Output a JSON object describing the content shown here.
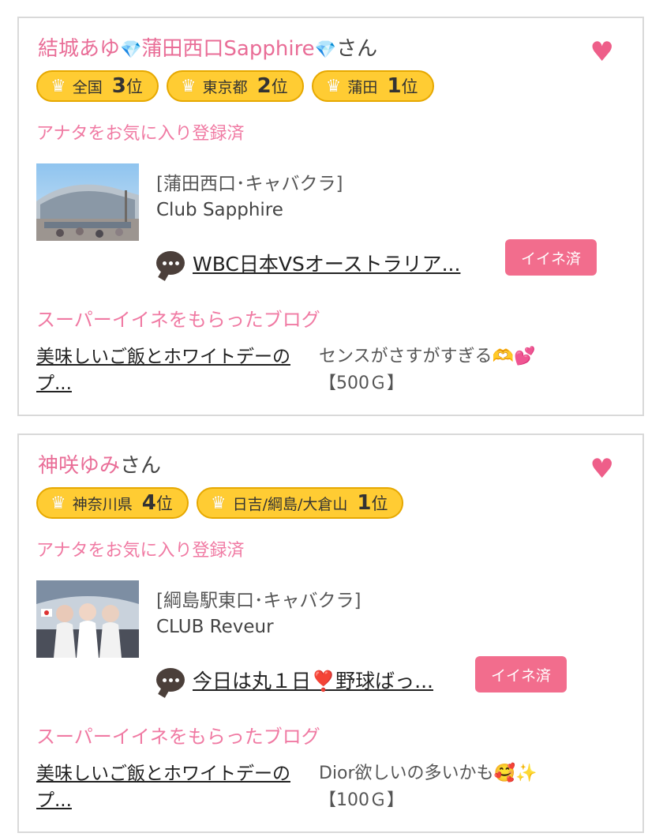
{
  "cards": [
    {
      "name_parts": [
        "結城あゆ",
        "💎",
        "蒲田西口Sapphire",
        "💎"
      ],
      "honorific": "さん",
      "heart_icon": "heart-icon",
      "ranks": [
        {
          "area": "全国",
          "rank": "3",
          "suffix": "位"
        },
        {
          "area": "東京都",
          "rank": "2",
          "suffix": "位"
        },
        {
          "area": "蒲田",
          "rank": "1",
          "suffix": "位"
        }
      ],
      "favorite_status": "アナタをお気に入り登録済",
      "shop_category": "[蒲田西口･キャバクラ]",
      "shop_name": "Club Sapphire",
      "post_title": "WBC日本VSオーストラリア...",
      "like_label": "イイネ済",
      "super_heading": "スーパーイイネをもらったブログ",
      "blog_title": "美味しいご飯とホワイトデーのプ...",
      "blog_comment": "センスがさすがすぎる🫶💕",
      "blog_points": "【500Ｇ】"
    },
    {
      "name_parts": [
        "神咲ゆみ"
      ],
      "honorific": "さん",
      "heart_icon": "heart-icon",
      "ranks": [
        {
          "area": "神奈川県",
          "rank": "4",
          "suffix": "位"
        },
        {
          "area": "日吉/綱島/大倉山",
          "rank": "1",
          "suffix": "位"
        }
      ],
      "favorite_status": "アナタをお気に入り登録済",
      "shop_category": "[綱島駅東口･キャバクラ]",
      "shop_name": "CLUB Reveur",
      "post_title": "今日は丸１日❣️野球ばっ...",
      "like_label": "イイネ済",
      "super_heading": "スーパーイイネをもらったブログ",
      "blog_title": "美味しいご飯とホワイトデーのプ...",
      "blog_comment": "Dior欲しいの多いかも🥰✨",
      "blog_points": "【100Ｇ】"
    }
  ],
  "colors": {
    "accent_pink": "#f07aa3",
    "button_pink": "#f26d8d",
    "badge_yellow": "#ffcc33",
    "heart": "#ee5e89"
  }
}
